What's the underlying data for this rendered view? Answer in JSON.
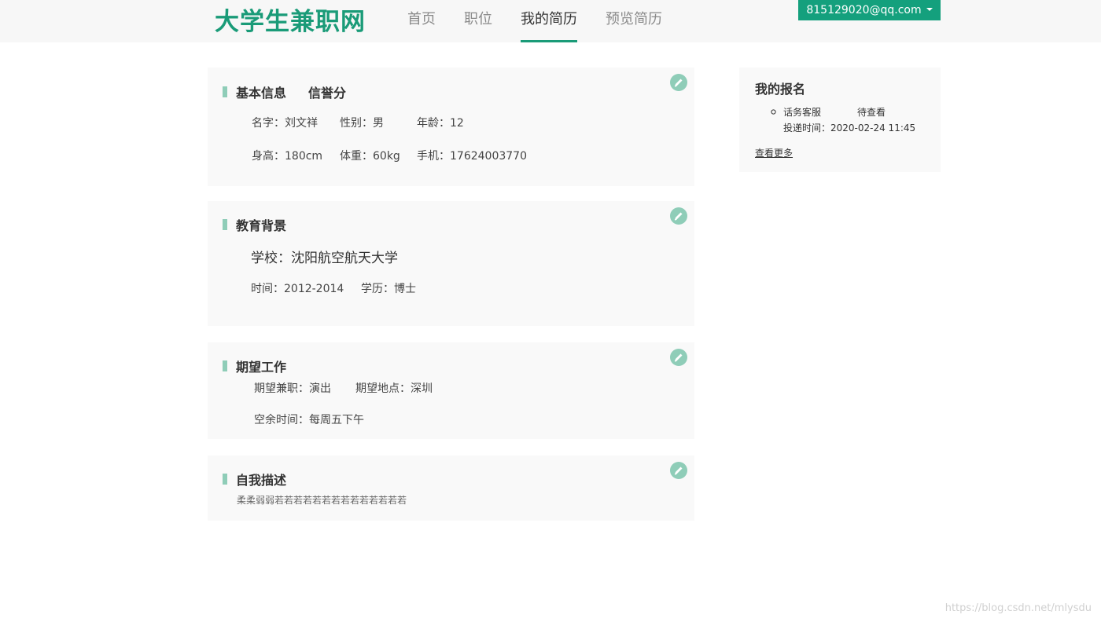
{
  "header": {
    "logo": "大学生兼职网",
    "nav": [
      "首页",
      "职位",
      "我的简历",
      "预览简历"
    ],
    "active_index": 2,
    "account_email": "815129020@qq.com"
  },
  "basic": {
    "title": "基本信息",
    "title2": "信誉分",
    "name": "名字：刘文祥",
    "gender": "性别：男",
    "age": "年龄：12",
    "height": "身高：180cm",
    "weight": "体重：60kg",
    "phone": "手机：17624003770"
  },
  "education": {
    "title": "教育背景",
    "school": "学校：沈阳航空航天大学",
    "time": "时间：2012-2014",
    "degree": "学历：博士"
  },
  "expect": {
    "title": "期望工作",
    "job": "期望兼职：演出",
    "place": "期望地点：深圳",
    "free_time": "空余时间：每周五下午"
  },
  "self": {
    "title": "自我描述",
    "text": "柔柔弱弱若若若若若若若若若若若若若若"
  },
  "sidebar": {
    "title": "我的报名",
    "job": "话务客服",
    "status": "待查看",
    "submit_time": "投递时间：2020-02-24 11:45",
    "more": "查看更多"
  },
  "watermark": "https://blog.csdn.net/mlysdu",
  "colors": {
    "accent": "#1a9b78",
    "button": "#14a07d",
    "soft": "#8fcdb8",
    "card": "#f9f9f9"
  }
}
